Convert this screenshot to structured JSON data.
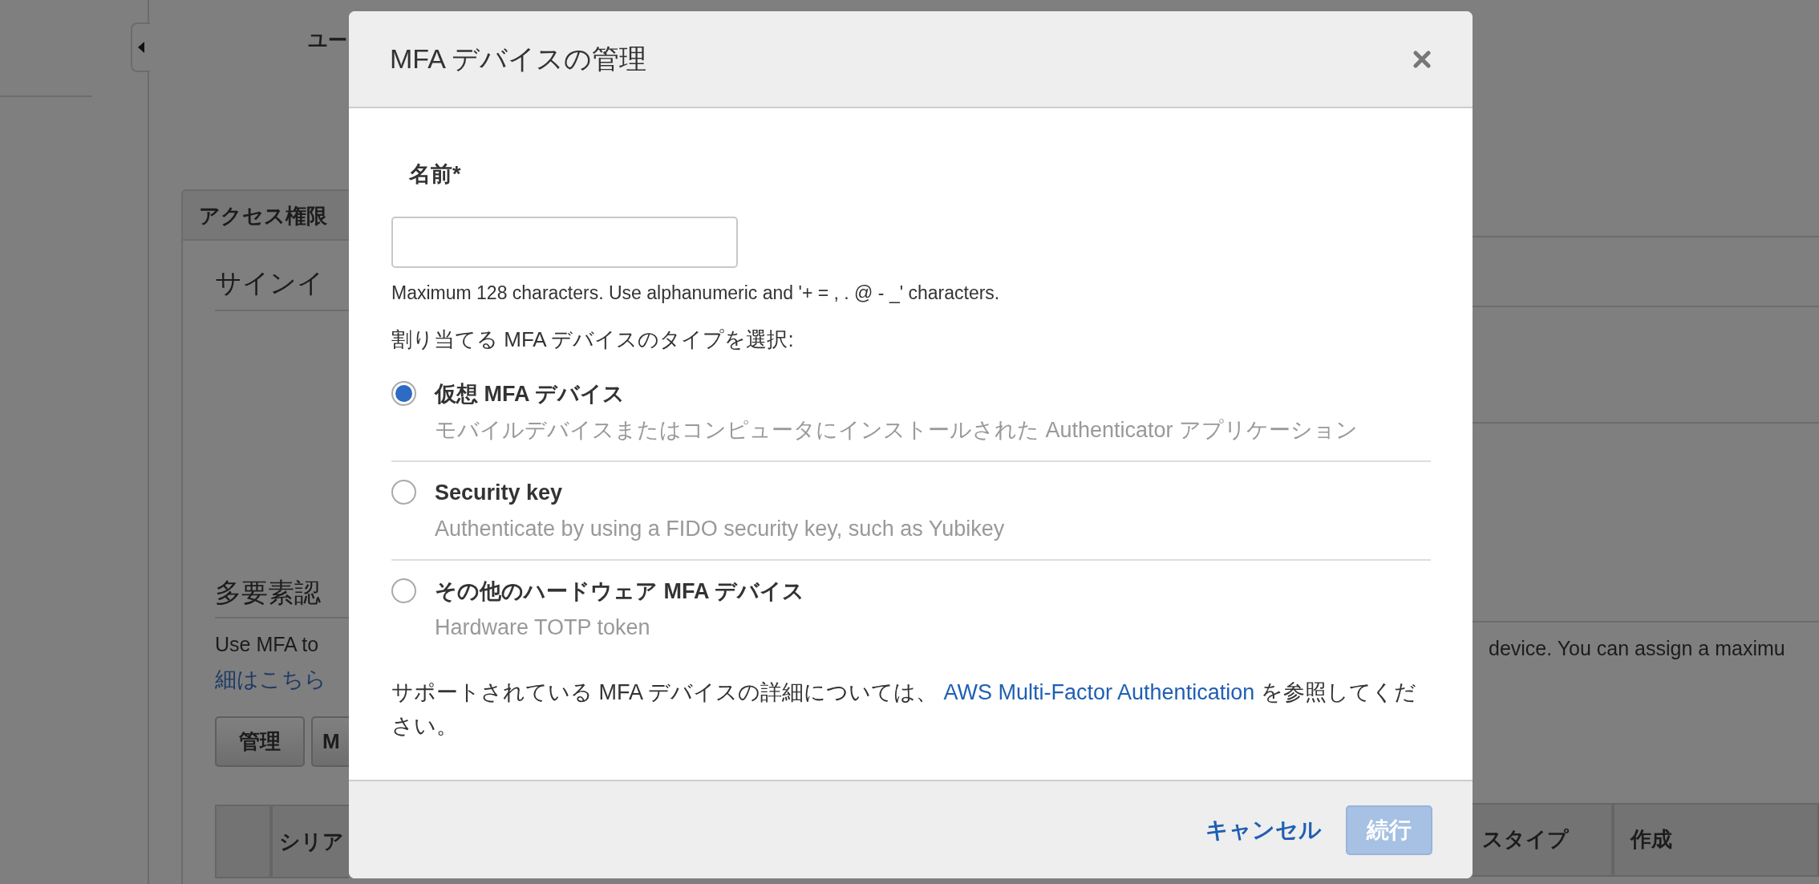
{
  "background": {
    "user_heading": "ユー",
    "tab": "アクセス権限",
    "signin_heading": "サインイ",
    "mfa_heading": "多要素認",
    "mfa_text_left": "Use MFA to",
    "mfa_text_right": "device. You can assign a maximu",
    "learn_more_link": "細はこちら",
    "buttons": [
      "管理",
      "M"
    ],
    "table_columns_left": [
      "シリア"
    ],
    "table_columns_right": [
      "スタイプ",
      "作成"
    ]
  },
  "modal": {
    "title": "MFA デバイスの管理",
    "name_field": {
      "label": "名前*",
      "hint": "Maximum 128 characters. Use alphanumeric and '+ = , . @ - _' characters."
    },
    "type_prompt": "割り当てる MFA デバイスのタイプを選択:",
    "options": [
      {
        "title": "仮想 MFA デバイス",
        "description": "モバイルデバイスまたはコンピュータにインストールされた Authenticator アプリケーション",
        "selected": true
      },
      {
        "title": "Security key",
        "description": "Authenticate by using a FIDO security key, such as Yubikey",
        "selected": false
      },
      {
        "title": "その他のハードウェア MFA デバイス",
        "description": "Hardware TOTP token",
        "selected": false
      }
    ],
    "note_before": "サポートされている MFA デバイスの詳細については、",
    "note_link": "AWS Multi-Factor Authentication",
    "note_after": "を参照してください。",
    "cancel": "キャンセル",
    "continue": {
      "label": "続行",
      "disabled": true
    }
  }
}
